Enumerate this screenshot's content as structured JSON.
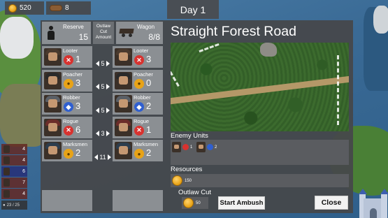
{
  "top_bar": {
    "gold": "520",
    "wood": "8",
    "day_label": "Day 1"
  },
  "party_sidebar": {
    "slots": [
      "4",
      "4",
      "6",
      "7",
      "4"
    ],
    "count": "23 / 25"
  },
  "header": {
    "reserve_label": "Reserve",
    "reserve_value": "15",
    "outlaw_cut_amount_label": "Outlaw Cut Amount",
    "wagon_label": "Wagon",
    "wagon_value": "8/8"
  },
  "reserve_units": [
    {
      "name": "Looter",
      "count": "1",
      "badge": "x-icon"
    },
    {
      "name": "Poacher",
      "count": "3",
      "badge": "coin-icon"
    },
    {
      "name": "Robber",
      "count": "3",
      "badge": "shield-icon"
    },
    {
      "name": "Rogue",
      "count": "6",
      "badge": "x-icon"
    },
    {
      "name": "Marksmen",
      "count": "2",
      "badge": "coin-icon"
    }
  ],
  "transfer_amounts": [
    "5",
    "5",
    "5",
    "3",
    "11"
  ],
  "wagon_units": [
    {
      "name": "Looter",
      "count": "3",
      "badge": "x-icon"
    },
    {
      "name": "Poacher",
      "count": "0",
      "badge": "coin-icon"
    },
    {
      "name": "Robber",
      "count": "2",
      "badge": "shield-icon"
    },
    {
      "name": "Rogue",
      "count": "1",
      "badge": "x-icon"
    },
    {
      "name": "Marksmen",
      "count": "2",
      "badge": "coin-icon"
    }
  ],
  "location": {
    "title": "Straight Forest Road",
    "enemy_units_label": "Enemy Units",
    "enemy_units": [
      {
        "count": "1",
        "badge": "x-icon"
      },
      {
        "count": "2",
        "badge": "shield-icon"
      }
    ],
    "resources_label": "Resources",
    "resources_value": "150",
    "outlaw_cut_label": "Outlaw Cut",
    "outlaw_cut_value": "50"
  },
  "buttons": {
    "start_ambush": "Start Ambush",
    "close": "Close"
  },
  "colors": {
    "panel": "#46484b",
    "card": "#8b8f93",
    "badge_red": "#d8322f",
    "badge_gold": "#e8a317",
    "badge_blue": "#2f5fd0"
  }
}
